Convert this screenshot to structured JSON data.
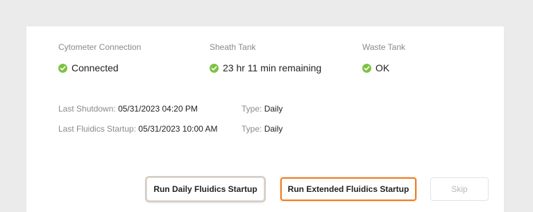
{
  "status": {
    "cytometer": {
      "label": "Cytometer Connection",
      "value": "Connected"
    },
    "sheath": {
      "label": "Sheath Tank",
      "value": "23 hr 11 min remaining"
    },
    "waste": {
      "label": "Waste Tank",
      "value": "OK"
    },
    "ok_color": "#7dc243"
  },
  "history": {
    "shutdown": {
      "label": "Last Shutdown:",
      "value": "05/31/2023 04:20 PM",
      "type_label": "Type:",
      "type_value": "Daily"
    },
    "startup": {
      "label": "Last Fluidics Startup:",
      "value": "05/31/2023 10:00 AM",
      "type_label": "Type:",
      "type_value": "Daily"
    }
  },
  "actions": {
    "daily_label": "Run Daily Fluidics Startup",
    "extended_label": "Run Extended Fluidics Startup",
    "skip_label": "Skip",
    "accent_color": "#ef7d23"
  }
}
